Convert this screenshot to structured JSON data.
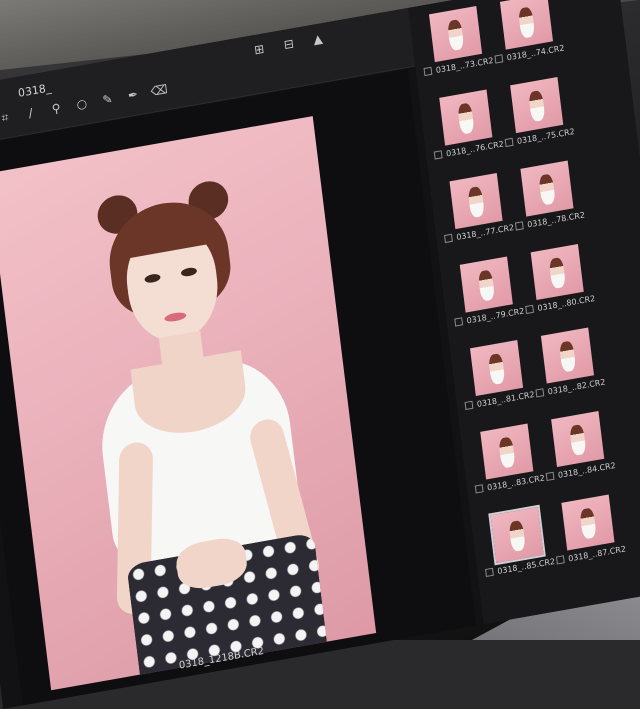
{
  "window": {
    "filename": "0318_"
  },
  "toolbar": {
    "tools_left": [
      "hand-icon",
      "crop-icon",
      "straighten-icon",
      "eyedropper-icon",
      "circle-icon",
      "brush-icon",
      "pen-icon",
      "eraser-icon"
    ],
    "tools_right": [
      "grid-icon",
      "compare-icon",
      "levels-icon",
      "exposure-slider",
      "settings-icon"
    ]
  },
  "viewer": {
    "caption": "0318_1218B.CR2",
    "colors": {
      "background": "#f3c1c8",
      "top_color": "#f7f7f5",
      "skirt_color": "#2c2a33"
    }
  },
  "filmstrip": {
    "thumbnails": [
      {
        "label": "0318_..73.CR2"
      },
      {
        "label": "0318_..74.CR2"
      },
      {
        "label": "0318_..76.CR2"
      },
      {
        "label": "0318_..75.CR2"
      },
      {
        "label": "0318_..77.CR2"
      },
      {
        "label": "0318_..78.CR2"
      },
      {
        "label": "0318_..79.CR2"
      },
      {
        "label": "0318_..80.CR2"
      },
      {
        "label": "0318_..81.CR2"
      },
      {
        "label": "0318_..82.CR2"
      },
      {
        "label": "0318_..83.CR2"
      },
      {
        "label": "0318_..84.CR2"
      },
      {
        "label": "0318_..85.CR2"
      },
      {
        "label": "0318_..87.CR2"
      }
    ]
  }
}
